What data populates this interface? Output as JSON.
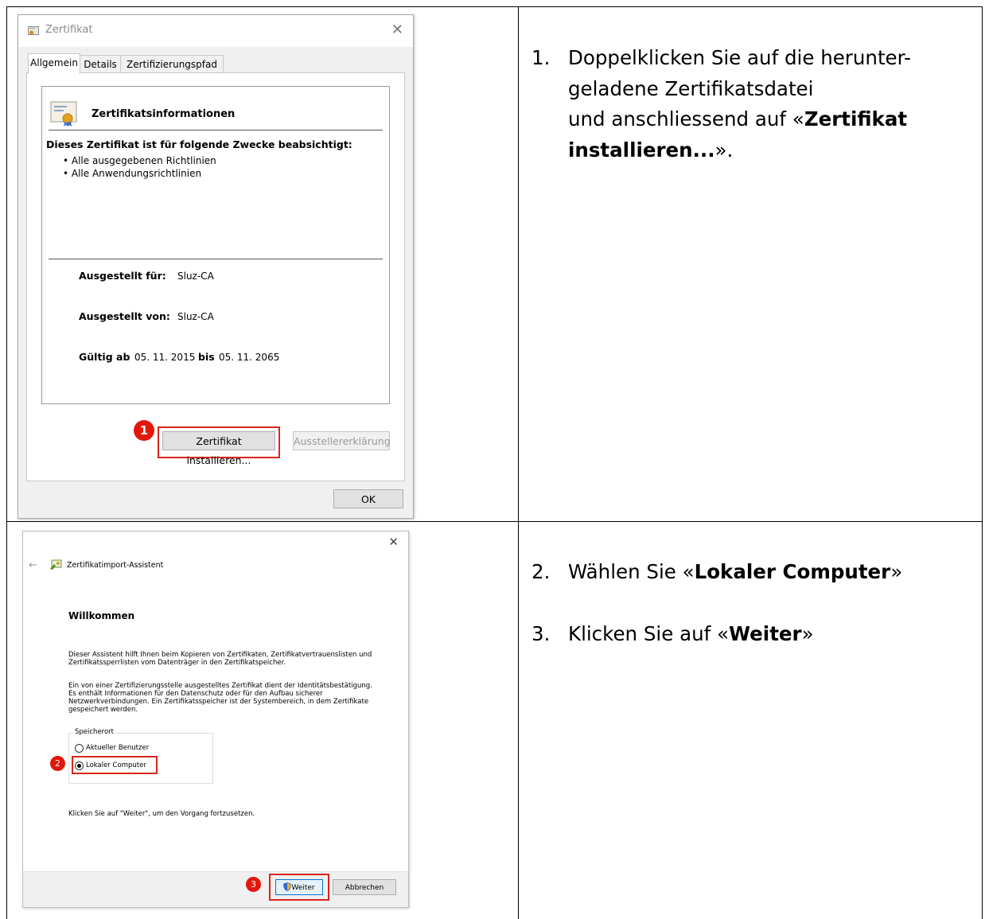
{
  "step1": {
    "dialog": {
      "title": "Zertifikat",
      "close_glyph": "✕",
      "tabs": [
        "Allgemein",
        "Details",
        "Zertifizierungspfad"
      ],
      "info_title": "Zertifikatsinformationen",
      "purpose_heading": "Dieses Zertifikat ist für folgende Zwecke beabsichtigt:",
      "purposes": [
        "• Alle ausgegebenen Richtlinien",
        "• Alle Anwendungsrichtlinien"
      ],
      "issued_to_label": "Ausgestellt für:",
      "issued_to_value": "Sluz-CA",
      "issued_by_label": "Ausgestellt von:",
      "issued_by_value": "Sluz-CA",
      "valid_from_label": "Gültig ab",
      "valid_from_value": "05. 11. 2015",
      "valid_to_label": "bis",
      "valid_to_value": "05. 11. 2065",
      "install_button": "Zertifikat installieren...",
      "issuer_statement_button": "Ausstellererklärung",
      "ok_button": "OK",
      "badge": "1"
    },
    "instruction": {
      "number": "1.",
      "line1": "Doppelklicken Sie auf die herunter-",
      "line2": "geladene Zertifikatsdatei",
      "line3_prefix": "und anschliessend auf «",
      "emphasis": "Zertifikat installieren...",
      "suffix": "»."
    }
  },
  "step2": {
    "dialog": {
      "close_glyph": "✕",
      "back_glyph": "←",
      "wizard_title": "Zertifikatimport-Assistent",
      "welcome": "Willkommen",
      "para1_line1": "Dieser Assistent hilft Ihnen beim Kopieren von Zertifikaten, Zertifikatvertrauenslisten und",
      "para1_line2": "Zertifikatssperrlisten vom Datenträger in den Zertifikatspeicher.",
      "para2_line1": "Ein von einer Zertifizierungsstelle ausgestelltes Zertifikat dient der Identitätsbestätigung.",
      "para2_line2": "Es enthält Informationen für den Datenschutz oder für den Aufbau sicherer",
      "para2_line3": "Netzwerkverbindungen. Ein Zertifikatsspeicher ist der Systembereich, in dem Zertifikate",
      "para2_line4": "gespeichert werden.",
      "store_group_label": "Speicherort",
      "option_current_user": "Aktueller Benutzer",
      "option_local_machine": "Lokaler Computer",
      "selected_option": "Lokaler Computer",
      "continue_hint": "Klicken Sie auf \"Weiter\", um den Vorgang fortzusetzen.",
      "next_button": "Weiter",
      "cancel_button": "Abbrechen",
      "badge_2": "2",
      "badge_3": "3"
    },
    "instruction_a": {
      "number": "2.",
      "prefix": "Wählen Sie «",
      "emphasis": "Lokaler Computer",
      "suffix": "»"
    },
    "instruction_b": {
      "number": "3.",
      "prefix": "Klicken Sie auf «",
      "emphasis": "Weiter",
      "suffix": "»"
    }
  },
  "colors": {
    "highlight_red": "#d9261c",
    "badge_red": "#e3170a",
    "dialog_bg": "#f0f0f0",
    "primary_button_border": "#0078d7"
  }
}
